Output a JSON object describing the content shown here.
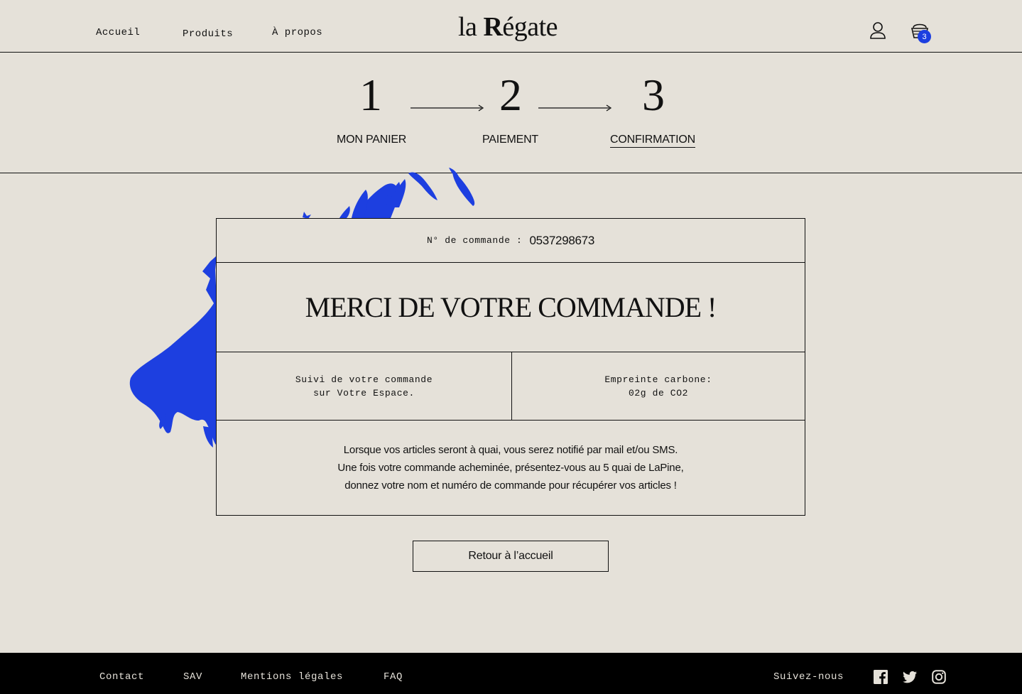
{
  "nav": {
    "links": [
      "Accueil",
      "Produits",
      "À propos"
    ],
    "logo_prefix": "la ",
    "logo_r": "R",
    "logo_suffix": "égate",
    "cart_count": "3"
  },
  "stepper": {
    "steps": [
      {
        "number": "1",
        "label": "MON PANIER"
      },
      {
        "number": "2",
        "label": "PAIEMENT"
      },
      {
        "number": "3",
        "label": "CONFIRMATION"
      }
    ]
  },
  "order": {
    "label": "N° de commande :",
    "number": "0537298673",
    "title": "MERCI DE VOTRE COMMANDE !",
    "tracking": "Suivi de votre commande\nsur Votre Espace.",
    "carbon": "Empreinte carbone:\n02g de CO2",
    "message_lines": [
      "Lorsque vos articles seront à quai, vous serez notifié par mail et/ou SMS.",
      "Une fois votre commande acheminée, présentez-vous au 5 quai de LaPine,",
      "donnez votre nom et numéro de commande pour récupérer vos articles !"
    ],
    "back_button": "Retour à l’accueil"
  },
  "footer": {
    "links": [
      "Contact",
      "SAV",
      "Mentions légales",
      "FAQ"
    ],
    "follow_label": "Suivez-nous",
    "social_icons": [
      "facebook-icon",
      "twitter-icon",
      "instagram-icon"
    ]
  },
  "colors": {
    "background": "#e5e1d9",
    "accent_blue": "#1d3fe0",
    "footer_bg": "#000000"
  }
}
